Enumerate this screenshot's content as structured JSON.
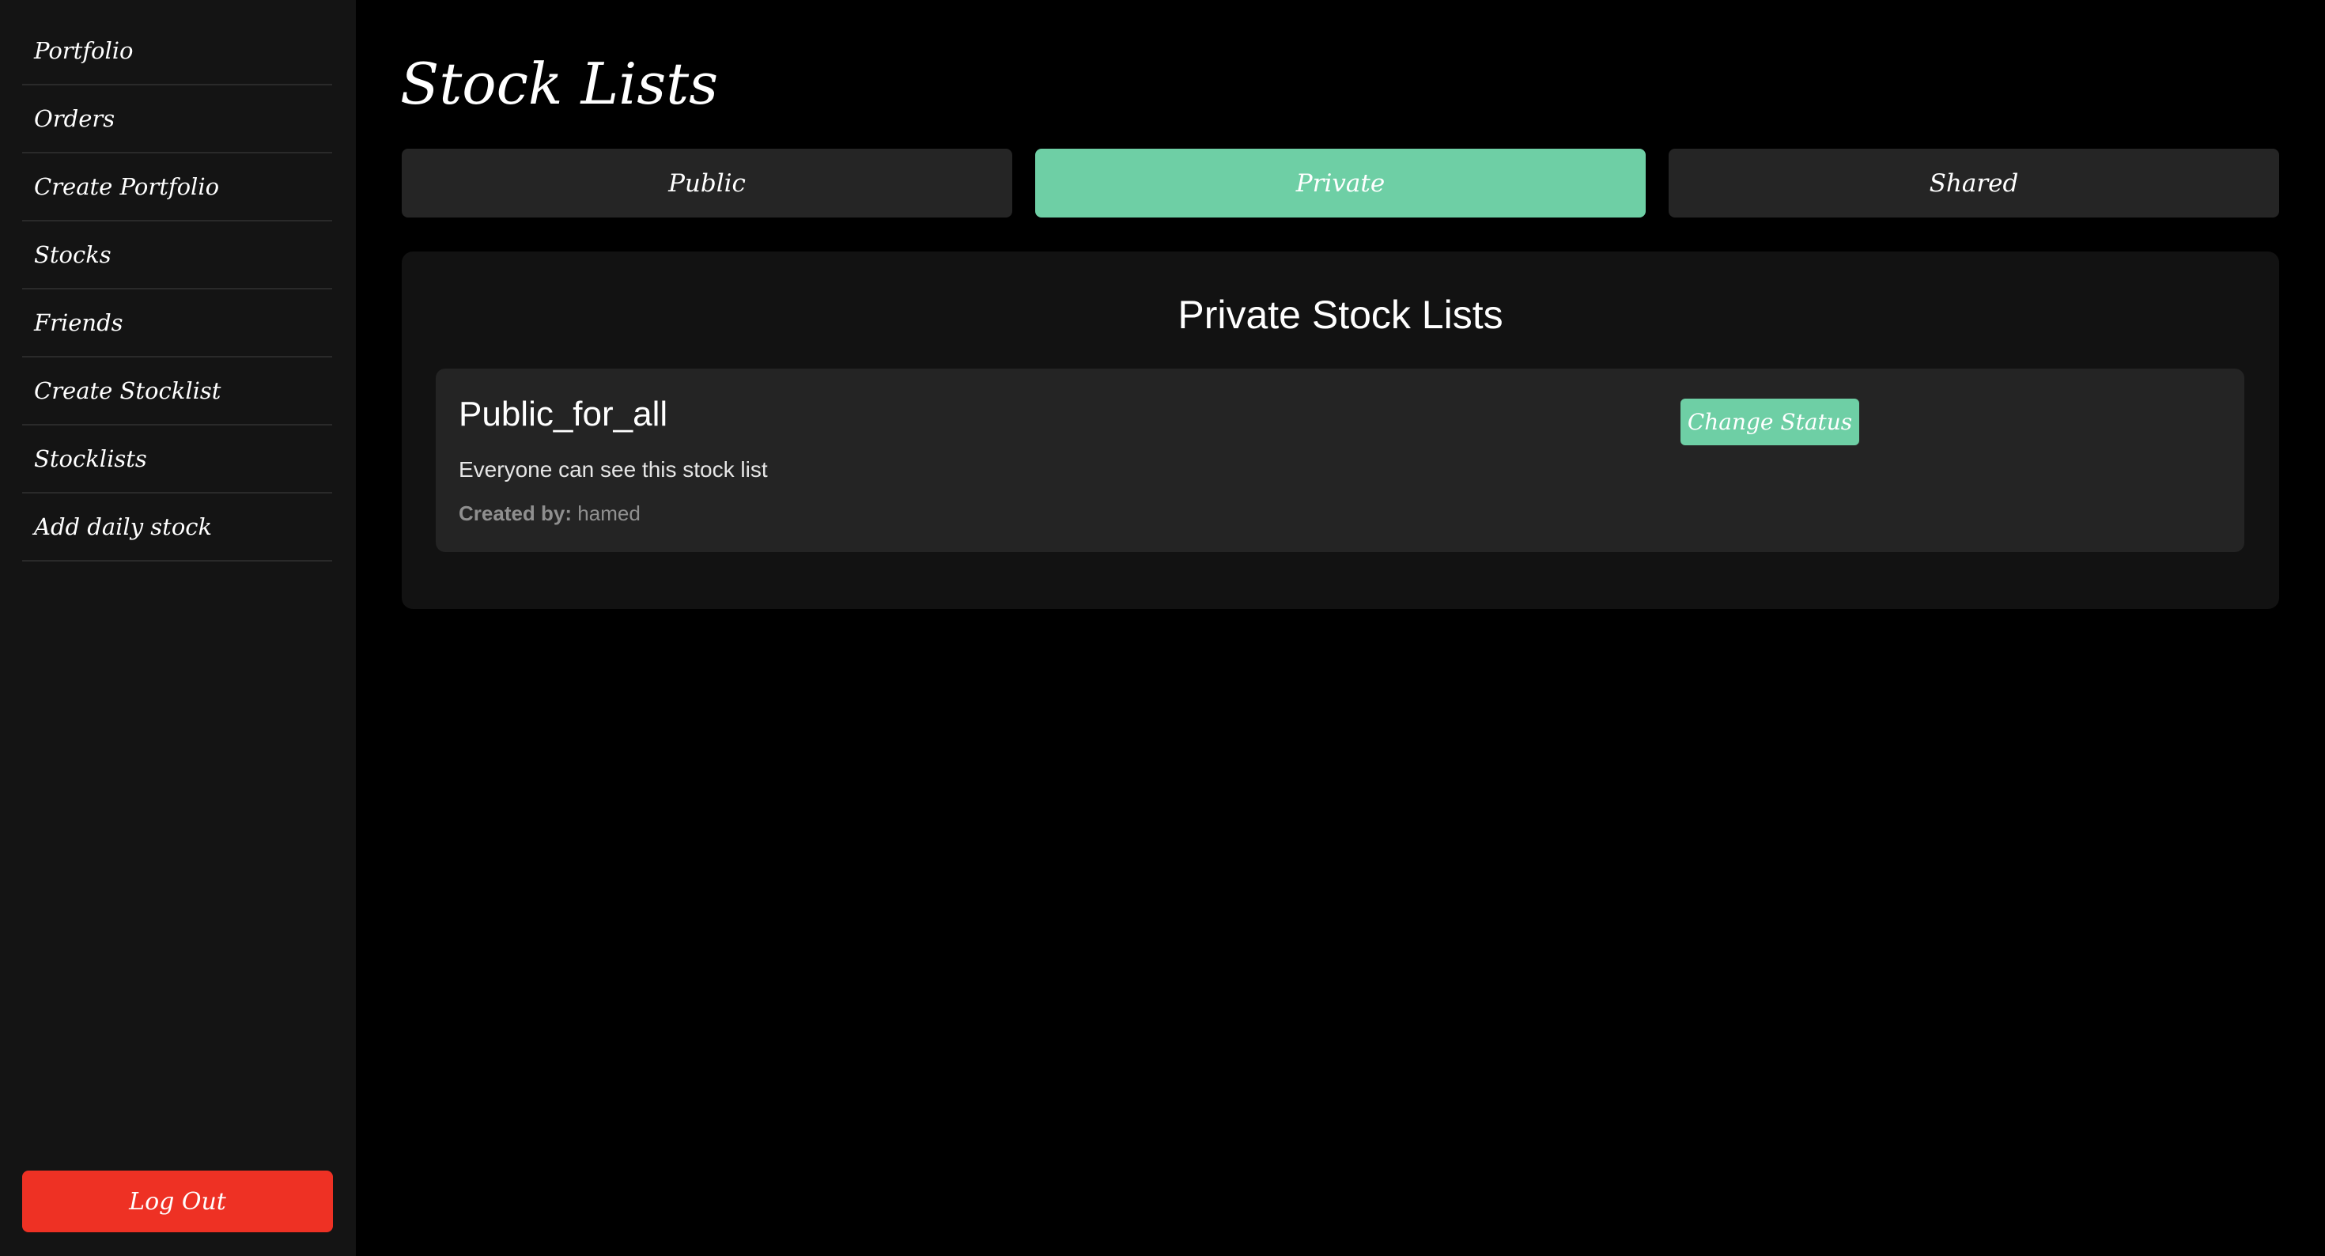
{
  "sidebar": {
    "items": [
      {
        "label": "Portfolio"
      },
      {
        "label": "Orders"
      },
      {
        "label": "Create Portfolio"
      },
      {
        "label": "Stocks"
      },
      {
        "label": "Friends"
      },
      {
        "label": "Create Stocklist"
      },
      {
        "label": "Stocklists"
      },
      {
        "label": "Add daily stock"
      }
    ],
    "logout_label": "Log Out"
  },
  "main": {
    "title": "Stock Lists",
    "tabs": [
      {
        "label": "Public",
        "active": false
      },
      {
        "label": "Private",
        "active": true
      },
      {
        "label": "Shared",
        "active": false
      }
    ],
    "panel_title": "Private Stock Lists",
    "lists": [
      {
        "name": "Public_for_all",
        "description": "Everyone can see this stock list",
        "created_by_label": "Created by:",
        "created_by": "hamed",
        "action_label": "Change Status"
      }
    ]
  },
  "colors": {
    "accent": "#6ecfa5",
    "danger": "#ee3124",
    "sidebar_bg": "#141414",
    "page_bg": "#000000",
    "card_bg": "#242424"
  }
}
